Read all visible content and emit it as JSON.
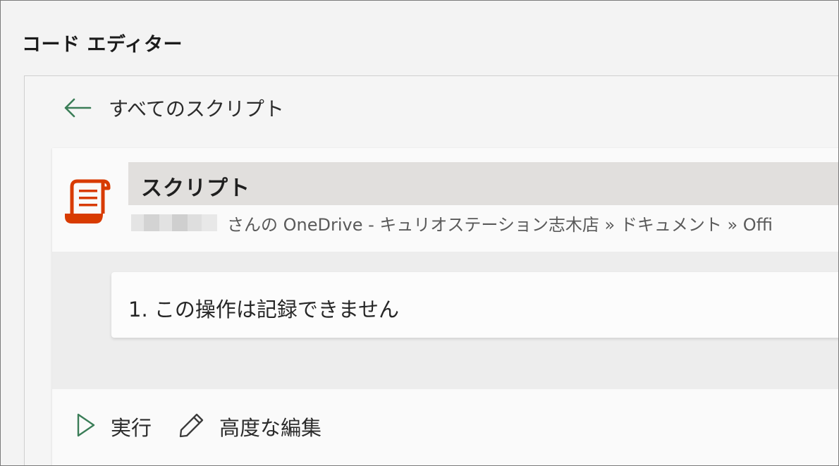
{
  "pane": {
    "title": "コード エディター"
  },
  "nav": {
    "back_label": "すべてのスクリプト",
    "back_icon": "arrow-left-icon"
  },
  "script": {
    "icon": "script-scroll-icon",
    "name": "スクリプト",
    "path": "さんの OneDrive - キュリオステーション志木店 » ドキュメント » Offi"
  },
  "steps": [
    {
      "text": "1. この操作は記録できません"
    }
  ],
  "actions": {
    "run_label": "実行",
    "run_icon": "play-icon",
    "edit_label": "高度な編集",
    "edit_icon": "pencil-icon"
  },
  "colors": {
    "accent_green": "#3a7d57",
    "script_icon_orange": "#d83b01"
  }
}
